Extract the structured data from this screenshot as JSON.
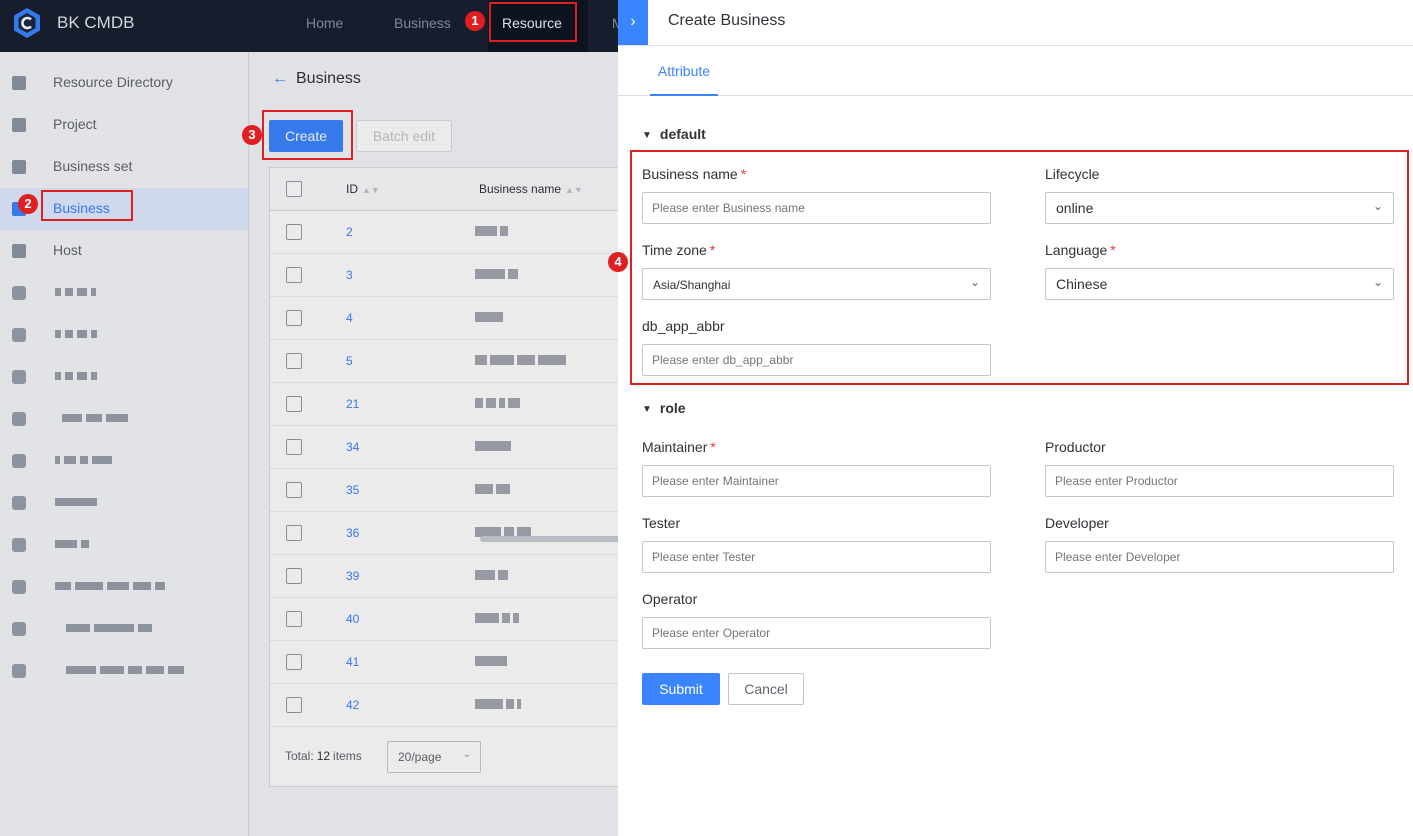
{
  "app": {
    "name": "BK CMDB"
  },
  "nav": {
    "home": "Home",
    "business": "Business",
    "resource": "Resource",
    "more": "M"
  },
  "sidebar": {
    "items": [
      {
        "label": "Resource Directory"
      },
      {
        "label": "Project"
      },
      {
        "label": "Business set"
      },
      {
        "label": "Business"
      },
      {
        "label": "Host"
      }
    ]
  },
  "main": {
    "title": "Business",
    "create_label": "Create",
    "batch_edit_label": "Batch edit",
    "columns": {
      "id": "ID",
      "name": "Business name"
    },
    "rows": [
      "2",
      "3",
      "4",
      "5",
      "21",
      "34",
      "35",
      "36",
      "39",
      "40",
      "41",
      "42"
    ],
    "footer": {
      "total_label": "Total:",
      "total_count": "12",
      "items_label": "items",
      "page_size": "20/page"
    }
  },
  "panel": {
    "title": "Create Business",
    "tab": "Attribute",
    "groups": {
      "default": "default",
      "role": "role"
    },
    "fields": {
      "business_name": {
        "label": "Business name",
        "placeholder": "Please enter Business name"
      },
      "lifecycle": {
        "label": "Lifecycle",
        "value": "online"
      },
      "time_zone": {
        "label": "Time zone",
        "value": "Asia/Shanghai"
      },
      "language": {
        "label": "Language",
        "value": "Chinese"
      },
      "db_app_abbr": {
        "label": "db_app_abbr",
        "placeholder": "Please enter db_app_abbr"
      },
      "maintainer": {
        "label": "Maintainer",
        "placeholder": "Please enter Maintainer"
      },
      "productor": {
        "label": "Productor",
        "placeholder": "Please enter Productor"
      },
      "tester": {
        "label": "Tester",
        "placeholder": "Please enter Tester"
      },
      "developer": {
        "label": "Developer",
        "placeholder": "Please enter Developer"
      },
      "operator": {
        "label": "Operator",
        "placeholder": "Please enter Operator"
      }
    },
    "required_mark": "*",
    "submit_label": "Submit",
    "cancel_label": "Cancel"
  },
  "annotations": {
    "m1": "1",
    "m2": "2",
    "m3": "3",
    "m4": "4"
  },
  "colors": {
    "primary": "#3a84ff",
    "topbar": "#182132",
    "highlight": "#e02020"
  }
}
